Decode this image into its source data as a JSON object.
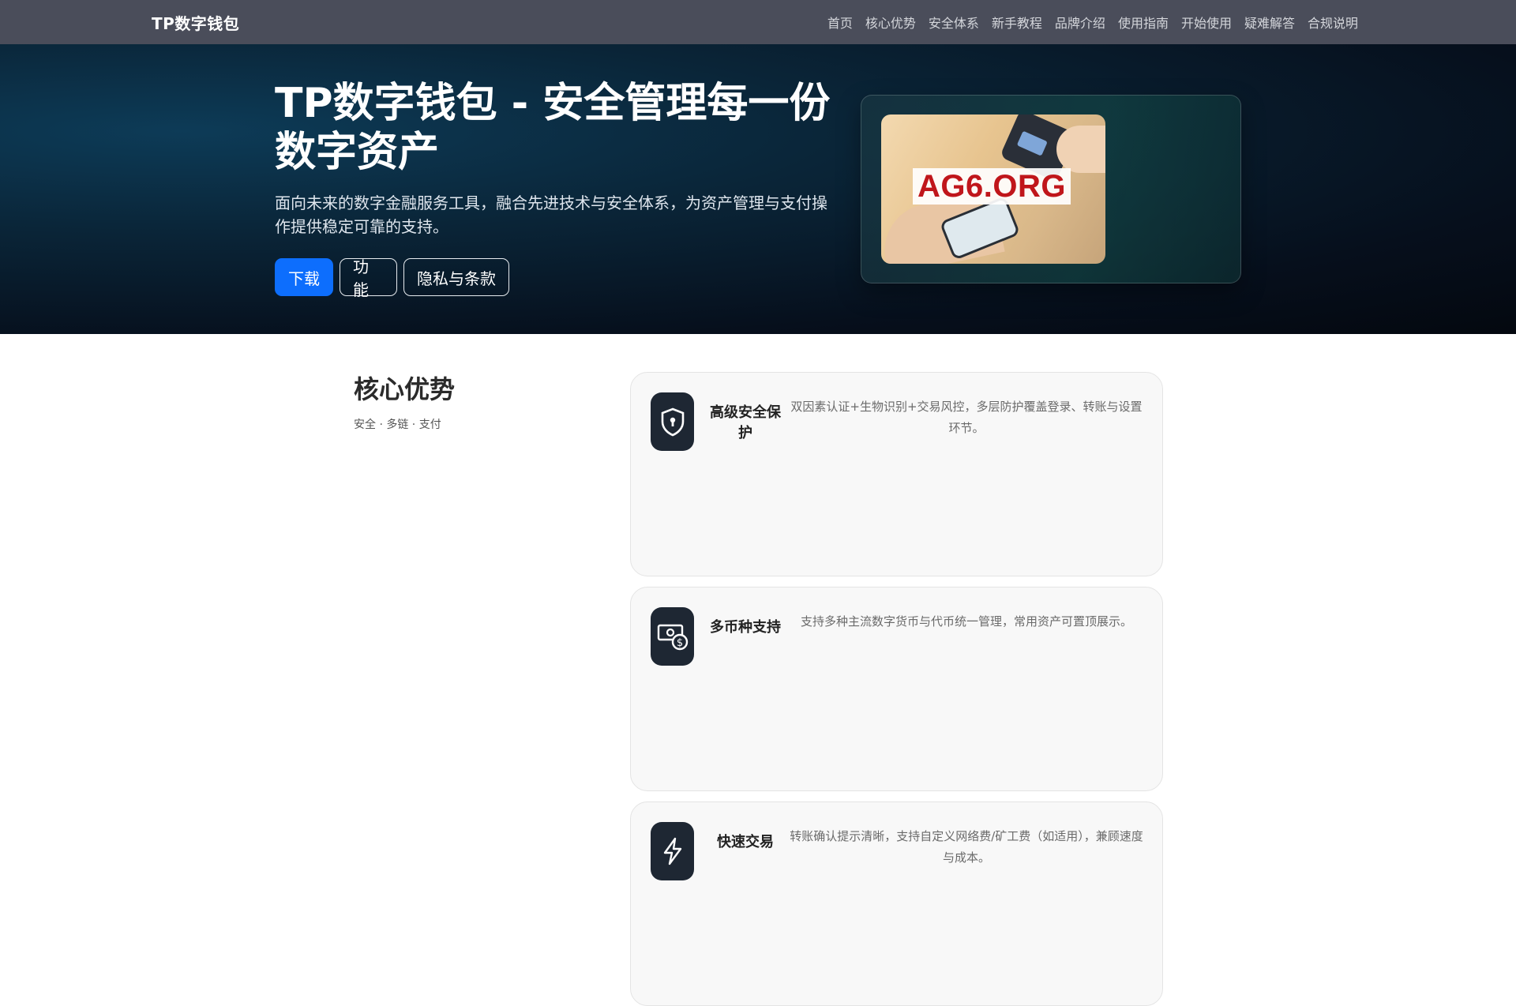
{
  "nav": {
    "brand": "TP数字钱包",
    "links": [
      "首页",
      "核心优势",
      "安全体系",
      "新手教程",
      "品牌介绍",
      "使用指南",
      "开始使用",
      "疑难解答",
      "合规说明"
    ]
  },
  "hero": {
    "title": "TP数字钱包 - 安全管理每一份数字资产",
    "description": "面向未来的数字金融服务工具，融合先进技术与安全体系，为资产管理与支付操作提供稳定可靠的支持。",
    "buttons": {
      "download": "下载",
      "features": "功能",
      "privacy": "隐私与条款"
    },
    "image_label": "AG6.ORG"
  },
  "features": {
    "title": "核心优势",
    "subtitle": "安全 · 多链 · 支付",
    "items": [
      {
        "title": "高级安全保护",
        "icon": "shield-keyhole-icon",
        "desc": "双因素认证+生物识别+交易风控，多层防护覆盖登录、转账与设置环节。"
      },
      {
        "title": "多币种支持",
        "icon": "cash-coin-icon",
        "desc": "支持多种主流数字货币与代币统一管理，常用资产可置顶展示。"
      },
      {
        "title": "快速交易",
        "icon": "lightning-icon",
        "desc": "转账确认提示清晰，支持自定义网络费/矿工费（如适用），兼顾速度与成本。"
      }
    ]
  },
  "colors": {
    "primary": "#0d6efd",
    "navbar": "#4a4d5a",
    "icon_bg": "#1e2733"
  }
}
